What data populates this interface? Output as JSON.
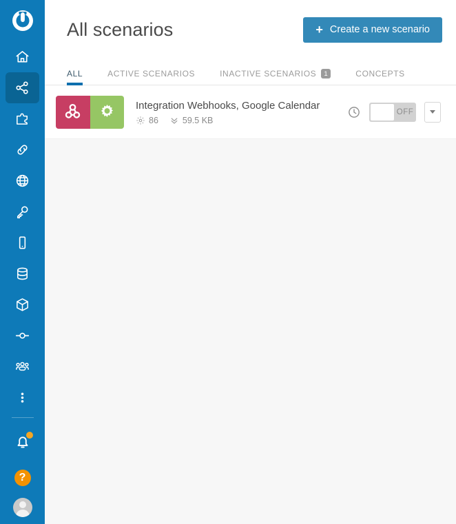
{
  "app": {
    "brand_name": "Integromat",
    "sidebar_color": "#0E7AB8",
    "accent_color": "#3389B8"
  },
  "sidebar": {
    "logo_name": "integromat-logo",
    "items": [
      {
        "id": "home",
        "icon": "home-icon",
        "label": "Home",
        "active": false
      },
      {
        "id": "scenarios",
        "icon": "share-nodes-icon",
        "label": "Scenarios",
        "active": true
      },
      {
        "id": "templates",
        "icon": "puzzle-icon",
        "label": "Templates",
        "active": false
      },
      {
        "id": "connections",
        "icon": "link-icon",
        "label": "Connections",
        "active": false
      },
      {
        "id": "webhooks",
        "icon": "globe-icon",
        "label": "Webhooks",
        "active": false
      },
      {
        "id": "keys",
        "icon": "key-icon",
        "label": "Keys",
        "active": false
      },
      {
        "id": "devices",
        "icon": "mobile-icon",
        "label": "Devices",
        "active": false
      },
      {
        "id": "datastores",
        "icon": "database-icon",
        "label": "Data stores",
        "active": false
      },
      {
        "id": "apps",
        "icon": "cube-icon",
        "label": "Apps",
        "active": false
      },
      {
        "id": "nodes",
        "icon": "node-icon",
        "label": "Nodes",
        "active": false
      },
      {
        "id": "team",
        "icon": "users-icon",
        "label": "Team",
        "active": false
      },
      {
        "id": "more",
        "icon": "more-vertical-icon",
        "label": "More",
        "active": false
      }
    ],
    "bottom": {
      "notifications_icon": "bell-icon",
      "notifications_badge_color": "#F5A623",
      "help_icon": "question-mark-icon",
      "help_label": "?",
      "help_color": "#F39200",
      "avatar_icon": "user-avatar-icon"
    }
  },
  "header": {
    "title": "All scenarios",
    "create_button": {
      "label": "Create a new scenario",
      "plus": "+"
    }
  },
  "tabs": [
    {
      "id": "all",
      "label": "ALL",
      "active": true,
      "badge": ""
    },
    {
      "id": "active",
      "label": "ACTIVE SCENARIOS",
      "active": false,
      "badge": ""
    },
    {
      "id": "inactive",
      "label": "INACTIVE SCENARIOS",
      "active": false,
      "badge": "1"
    },
    {
      "id": "concepts",
      "label": "CONCEPTS",
      "active": false,
      "badge": ""
    }
  ],
  "scenarios": [
    {
      "title": "Integration Webhooks, Google Calendar",
      "app_icons": [
        {
          "name": "webhooks-icon",
          "color": "#C73E63"
        },
        {
          "name": "google-calendar-icon",
          "color": "#96C664"
        }
      ],
      "operations": {
        "icon": "gear-icon",
        "value": "86"
      },
      "data_transfer": {
        "icon": "chevrons-down-icon",
        "value": "59.5 KB"
      },
      "schedule_icon": "clock-icon",
      "toggle": {
        "state_label": "OFF",
        "enabled": false
      },
      "menu_icon": "chevron-down-icon"
    }
  ]
}
